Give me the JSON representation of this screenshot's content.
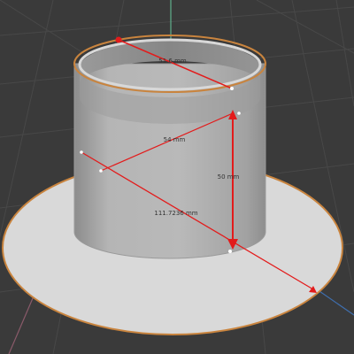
{
  "viewport": {
    "background": "#3a3a3a",
    "grid_color": "#4a4a4a",
    "axis_y_color": "#5fb08c",
    "axis_x_color": "#8a5a6a",
    "axis_z_color": "#3f6fae"
  },
  "model": {
    "flange_color": "#d9d9d9",
    "flange_edge_color": "#c9843e",
    "cylinder_color": "#a9a9a9",
    "cylinder_inner_color": "#8f8f8f"
  },
  "measurements": {
    "line_color": "#e31b1b",
    "inner_diameter": "51.6 mm",
    "radius": "54 mm",
    "height": "50 mm",
    "outer_diameter": "111.7236 mm"
  }
}
